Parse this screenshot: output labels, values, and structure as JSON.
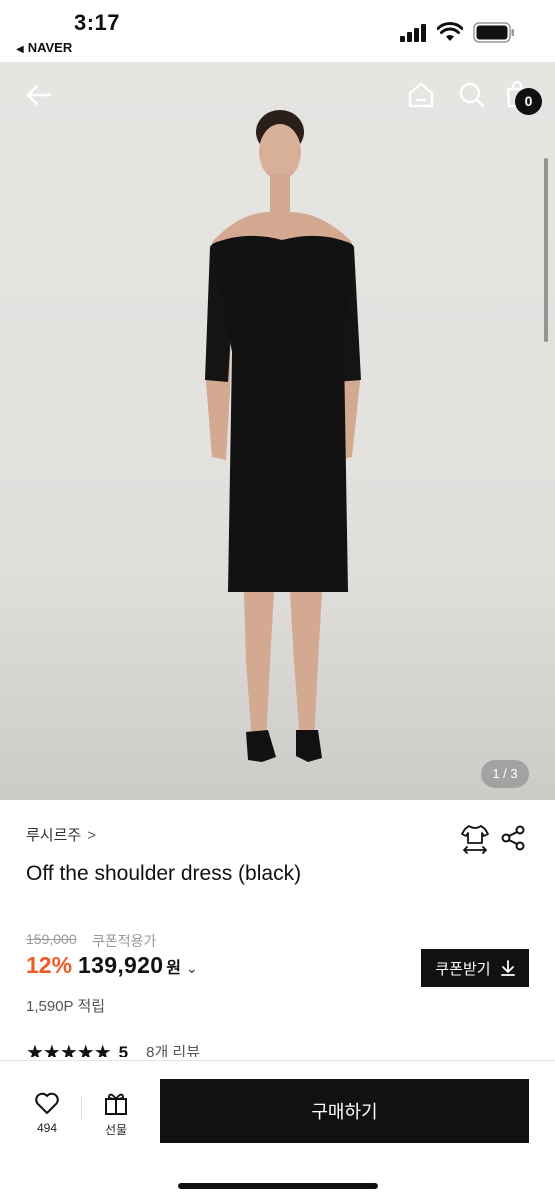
{
  "status_bar": {
    "time": "3:17",
    "back_app": "NAVER"
  },
  "hero": {
    "image_counter": "1 / 3",
    "cart_count": "0",
    "icons": [
      "back-arrow-icon",
      "home-icon",
      "search-icon",
      "shopping-bag-icon"
    ]
  },
  "product": {
    "brand": "루시르주",
    "title": "Off the shoulder dress (black)",
    "original_price": "159,000",
    "coupon_note": "쿠폰적용가",
    "discount": "12%",
    "price": "139,920",
    "currency": "원",
    "coupon_button": "쿠폰받기",
    "points": "1,590P 적립",
    "stars": "★★★★★",
    "rating": "5",
    "review_count": "8개 리뷰"
  },
  "bottom_bar": {
    "like_count": "494",
    "gift_label": "선물",
    "buy_label": "구매하기"
  },
  "colors": {
    "accent": "#f05a24",
    "primary": "#111111",
    "muted": "#999999"
  }
}
